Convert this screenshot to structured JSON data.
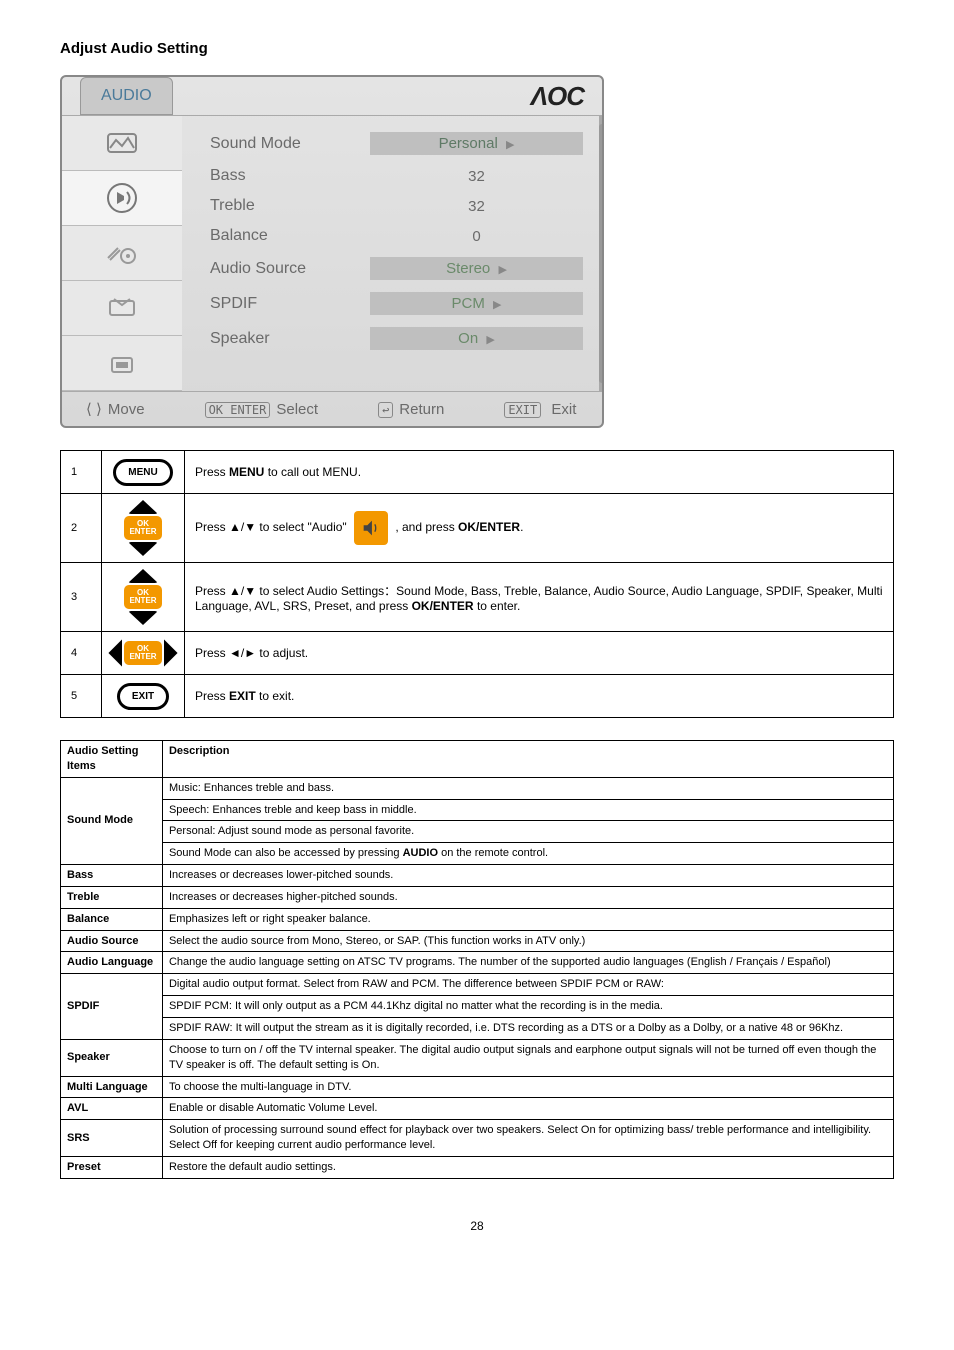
{
  "heading": "Adjust Audio Setting",
  "osd": {
    "tab": "AUDIO",
    "logo": "ΛOC",
    "rows": [
      {
        "label": "Sound Mode",
        "value": "Personal",
        "type": "select"
      },
      {
        "label": "Bass",
        "value": "32",
        "type": "num"
      },
      {
        "label": "Treble",
        "value": "32",
        "type": "num"
      },
      {
        "label": "Balance",
        "value": "0",
        "type": "num"
      },
      {
        "label": "Audio Source",
        "value": "Stereo",
        "type": "select"
      },
      {
        "label": "SPDIF",
        "value": "PCM",
        "type": "select"
      },
      {
        "label": "Speaker",
        "value": "On",
        "type": "select"
      }
    ],
    "footer": {
      "move": "Move",
      "select_key": "OK\nENTER",
      "select": "Select",
      "return": "Return",
      "exit_key": "EXIT",
      "exit": "Exit"
    }
  },
  "steps": [
    {
      "n": "1",
      "icon": "MENU",
      "text_pre": "Press ",
      "text_b": "MENU",
      "text_post": " to call out MENU."
    },
    {
      "n": "2",
      "icon": "updown",
      "text_pre": "Press ▲/▼ to select \"Audio\" ",
      "speaker": true,
      "text_mid": " , and press ",
      "text_b": "OK/ENTER",
      "text_post": "."
    },
    {
      "n": "3",
      "icon": "updown",
      "text_pre": "Press ▲/▼ to select Audio Settings：Sound Mode, Bass, Treble, Balance, Audio Source, Audio Language, SPDIF, Speaker, Multi Language, AVL, SRS, Preset, and press ",
      "text_b": "OK/ENTER",
      "text_post": " to enter."
    },
    {
      "n": "4",
      "icon": "leftright",
      "text_pre": "Press ◄/► to adjust."
    },
    {
      "n": "5",
      "icon": "EXIT",
      "text_pre": "Press ",
      "text_b": "EXIT",
      "text_post": " to exit."
    }
  ],
  "settings_header": {
    "c1": "Audio Setting Items",
    "c2": "Description"
  },
  "settings": [
    {
      "label": "Sound Mode",
      "rows": [
        "Music: Enhances treble and bass.",
        "Speech: Enhances treble and keep bass in middle.",
        "Personal: Adjust sound mode as personal favorite.",
        {
          "pre": "Sound Mode can also be accessed by pressing ",
          "b": "AUDIO",
          "post": " on the remote control."
        }
      ]
    },
    {
      "label": "Bass",
      "rows": [
        "Increases or decreases lower-pitched sounds."
      ]
    },
    {
      "label": "Treble",
      "rows": [
        "Increases or decreases higher-pitched sounds."
      ]
    },
    {
      "label": "Balance",
      "rows": [
        "Emphasizes left or right speaker balance."
      ]
    },
    {
      "label": "Audio Source",
      "rows": [
        "Select the audio source from Mono, Stereo, or SAP. (This function works in ATV only.)"
      ]
    },
    {
      "label": "Audio Language",
      "rows": [
        "Change the audio language setting on ATSC TV programs. The number of the supported audio languages (English / Français / Español)"
      ]
    },
    {
      "label": "SPDIF",
      "rows": [
        "Digital audio output format. Select from RAW and PCM. The difference between SPDIF PCM or RAW:",
        "SPDIF PCM: It will only output as a PCM 44.1Khz digital no matter what the recording is in the media.",
        "SPDIF RAW: It will output the stream as it is digitally recorded, i.e. DTS recording as a DTS or a Dolby as a Dolby, or a native 48 or 96Khz."
      ]
    },
    {
      "label": "Speaker",
      "rows": [
        "Choose to turn on / off the TV internal speaker. The digital audio output signals and earphone output signals will not be turned off even though the TV speaker is off. The default setting is On."
      ]
    },
    {
      "label": "Multi Language",
      "rows": [
        "To choose the multi-language in DTV."
      ]
    },
    {
      "label": "AVL",
      "rows": [
        "Enable or disable Automatic Volume Level."
      ]
    },
    {
      "label": "SRS",
      "rows": [
        "Solution of processing surround sound effect for playback over two speakers. Select On for optimizing bass/ treble performance and intelligibility. Select Off for keeping current audio performance level."
      ]
    },
    {
      "label": "Preset",
      "rows": [
        "Restore the default audio settings."
      ]
    }
  ],
  "pagenum": "28"
}
